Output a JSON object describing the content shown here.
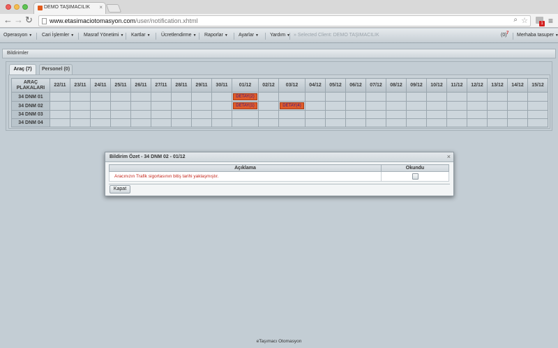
{
  "browser": {
    "tab_title": "DEMO TAŞIMACILIK",
    "tab_close": "×",
    "url_host": "www.etasimaciotomasyon.com",
    "url_path": "/user/notification.xhtml",
    "ext_badge": "1",
    "icons": {
      "back": "arrow-left-icon",
      "forward": "arrow-right-icon",
      "reload": "reload-icon",
      "zoom": "zoom-icon",
      "bookmark": "star-icon",
      "menu": "hamburger-icon"
    }
  },
  "menubar": {
    "items": [
      "Operasyon",
      "Cari İşlemler",
      "Masraf Yönetimi",
      "Kartlar",
      "Ücretlendirme",
      "Raporlar",
      "Ayarlar",
      "Yardım"
    ],
    "selected_client": "» Selected Client: DEMO TAŞIMACILIK",
    "notif_count": "(0)",
    "notif_badge": "7",
    "user_menu": "Merhaba tasuper"
  },
  "panel": {
    "title": "Bildirimler",
    "tabs": [
      "Araç (7)",
      "Personel (0)"
    ]
  },
  "grid": {
    "corner_line1": "ARAÇ",
    "corner_line2": "PLAKALARI",
    "dates": [
      "22/11",
      "23/11",
      "24/11",
      "25/11",
      "26/11",
      "27/11",
      "28/11",
      "29/11",
      "30/11",
      "01/12",
      "02/12",
      "03/12",
      "04/12",
      "05/12",
      "06/12",
      "07/12",
      "08/12",
      "09/12",
      "10/12",
      "11/12",
      "12/12",
      "13/12",
      "14/12",
      "15/12"
    ],
    "rows": [
      {
        "plate": "34 DNM 01",
        "details": {
          "9": "DETAY(2)"
        }
      },
      {
        "plate": "34 DNM 02",
        "details": {
          "9": "DETAY(1)",
          "11": "DETAY(4)"
        }
      },
      {
        "plate": "34 DNM 03",
        "details": {}
      },
      {
        "plate": "34 DNM 04",
        "details": {}
      }
    ],
    "detail_color": "#e05b2a"
  },
  "dialog": {
    "title": "Bildirim Özet - 34 DNM 02 - 01/12",
    "close": "×",
    "col_description": "Açıklama",
    "col_read": "Okundu",
    "rows": [
      {
        "text": "Aracınızın Trafik sigortasının bitiş tarihi yaklaşmıştır.",
        "read": false
      }
    ],
    "close_button": "Kapat"
  },
  "footer": {
    "text": "eTaşımacı Otomasyon"
  }
}
